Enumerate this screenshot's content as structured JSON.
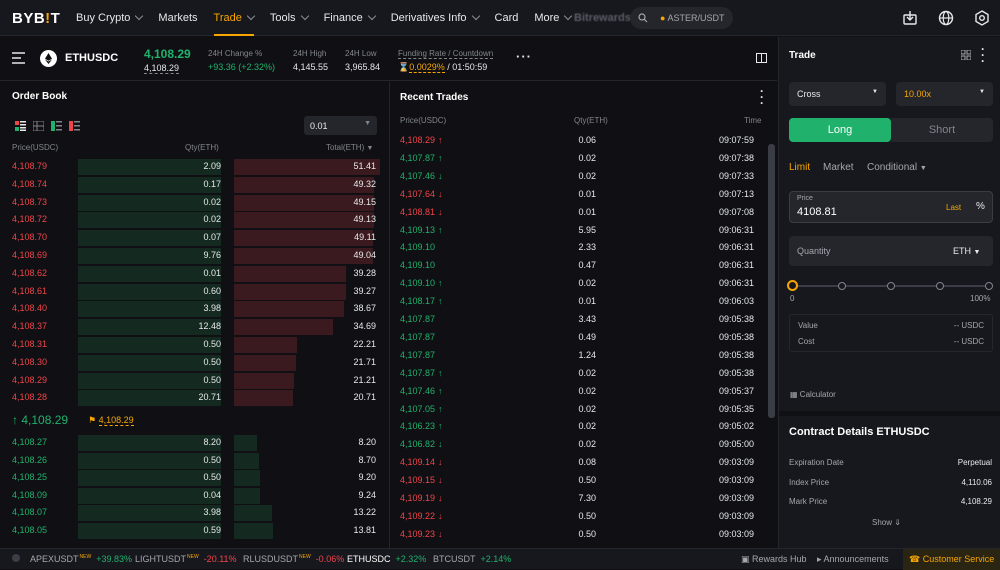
{
  "nav": {
    "logo_main": "BYB",
    "logo_accent": "!",
    "logo_end": "T",
    "items": [
      {
        "label": "Buy Crypto",
        "chevron": true
      },
      {
        "label": "Markets",
        "chevron": false
      },
      {
        "label": "Trade",
        "chevron": true,
        "active": true
      },
      {
        "label": "Tools",
        "chevron": true
      },
      {
        "label": "Finance",
        "chevron": true
      },
      {
        "label": "Derivatives Info",
        "chevron": true
      },
      {
        "label": "Card",
        "chevron": false
      },
      {
        "label": "More",
        "chevron": true
      }
    ],
    "blurred_label": "Bitrewards",
    "search_text": "ASTER/USDT",
    "icons": [
      "download-icon",
      "globe-icon",
      "settings-icon"
    ]
  },
  "ticker": {
    "symbol": "ETHUSDC",
    "last_price": "4,108.29",
    "mark_price": "4,108.29",
    "change_label": "24H Change %",
    "change_value": "+93.36 (+2.32%)",
    "high_label": "24H High",
    "high_value": "4,145.55",
    "low_label": "24H Low",
    "low_value": "3,965.84",
    "funding_label": "Funding Rate / Countdown",
    "funding_rate": "0.0029%",
    "countdown": "/ 01:50:59"
  },
  "orderbook": {
    "title": "Order Book",
    "precision": "0.01",
    "headers": {
      "price": "Price(USDC)",
      "qty": "Qty(ETH)",
      "total": "Total(ETH)"
    },
    "asks": [
      {
        "price": "4,108.79",
        "qty": "2.09",
        "total": "51.41",
        "depth": 1.0
      },
      {
        "price": "4,108.74",
        "qty": "0.17",
        "total": "49.32",
        "depth": 0.96
      },
      {
        "price": "4,108.73",
        "qty": "0.02",
        "total": "49.15",
        "depth": 0.956
      },
      {
        "price": "4,108.72",
        "qty": "0.02",
        "total": "49.13",
        "depth": 0.956
      },
      {
        "price": "4,108.70",
        "qty": "0.07",
        "total": "49.11",
        "depth": 0.955
      },
      {
        "price": "4,108.69",
        "qty": "9.76",
        "total": "49.04",
        "depth": 0.954
      },
      {
        "price": "4,108.62",
        "qty": "0.01",
        "total": "39.28",
        "depth": 0.764
      },
      {
        "price": "4,108.61",
        "qty": "0.60",
        "total": "39.27",
        "depth": 0.764
      },
      {
        "price": "4,108.40",
        "qty": "3.98",
        "total": "38.67",
        "depth": 0.752
      },
      {
        "price": "4,108.37",
        "qty": "12.48",
        "total": "34.69",
        "depth": 0.675
      },
      {
        "price": "4,108.31",
        "qty": "0.50",
        "total": "22.21",
        "depth": 0.432
      },
      {
        "price": "4,108.30",
        "qty": "0.50",
        "total": "21.71",
        "depth": 0.422
      },
      {
        "price": "4,108.29",
        "qty": "0.50",
        "total": "21.21",
        "depth": 0.413
      },
      {
        "price": "4,108.28",
        "qty": "20.71",
        "total": "20.71",
        "depth": 0.403
      }
    ],
    "mid_price": "4,108.29",
    "mid_mark": "4,108.29",
    "bids": [
      {
        "price": "4,108.27",
        "qty": "8.20",
        "total": "8.20",
        "depth": 0.16
      },
      {
        "price": "4,108.26",
        "qty": "0.50",
        "total": "8.70",
        "depth": 0.169
      },
      {
        "price": "4,108.25",
        "qty": "0.50",
        "total": "9.20",
        "depth": 0.179
      },
      {
        "price": "4,108.09",
        "qty": "0.04",
        "total": "9.24",
        "depth": 0.18
      },
      {
        "price": "4,108.07",
        "qty": "3.98",
        "total": "13.22",
        "depth": 0.257
      },
      {
        "price": "4,108.05",
        "qty": "0.59",
        "total": "13.81",
        "depth": 0.269
      }
    ]
  },
  "trades": {
    "title": "Recent Trades",
    "headers": {
      "price": "Price(USDC)",
      "qty": "Qty(ETH)",
      "time": "Time"
    },
    "rows": [
      {
        "price": "4,108.29",
        "dir": "up",
        "side": "sell",
        "qty": "0.06",
        "time": "09:07:59"
      },
      {
        "price": "4,107.87",
        "dir": "up",
        "side": "buy",
        "qty": "0.02",
        "time": "09:07:38"
      },
      {
        "price": "4,107.46",
        "dir": "down",
        "side": "buy",
        "qty": "0.02",
        "time": "09:07:33"
      },
      {
        "price": "4,107.64",
        "dir": "down",
        "side": "sell",
        "qty": "0.01",
        "time": "09:07:13"
      },
      {
        "price": "4,108.81",
        "dir": "down",
        "side": "sell",
        "qty": "0.01",
        "time": "09:07:08"
      },
      {
        "price": "4,109.13",
        "dir": "up",
        "side": "buy",
        "qty": "5.95",
        "time": "09:06:31"
      },
      {
        "price": "4,109.10",
        "dir": "",
        "side": "buy",
        "qty": "2.33",
        "time": "09:06:31"
      },
      {
        "price": "4,109.10",
        "dir": "",
        "side": "buy",
        "qty": "0.47",
        "time": "09:06:31"
      },
      {
        "price": "4,109.10",
        "dir": "up",
        "side": "buy",
        "qty": "0.02",
        "time": "09:06:31"
      },
      {
        "price": "4,108.17",
        "dir": "up",
        "side": "buy",
        "qty": "0.01",
        "time": "09:06:03"
      },
      {
        "price": "4,107.87",
        "dir": "",
        "side": "buy",
        "qty": "3.43",
        "time": "09:05:38"
      },
      {
        "price": "4,107.87",
        "dir": "",
        "side": "buy",
        "qty": "0.49",
        "time": "09:05:38"
      },
      {
        "price": "4,107.87",
        "dir": "",
        "side": "buy",
        "qty": "1.24",
        "time": "09:05:38"
      },
      {
        "price": "4,107.87",
        "dir": "up",
        "side": "buy",
        "qty": "0.02",
        "time": "09:05:38"
      },
      {
        "price": "4,107.46",
        "dir": "up",
        "side": "buy",
        "qty": "0.02",
        "time": "09:05:37"
      },
      {
        "price": "4,107.05",
        "dir": "up",
        "side": "buy",
        "qty": "0.02",
        "time": "09:05:35"
      },
      {
        "price": "4,106.23",
        "dir": "up",
        "side": "buy",
        "qty": "0.02",
        "time": "09:05:02"
      },
      {
        "price": "4,106.82",
        "dir": "down",
        "side": "buy",
        "qty": "0.02",
        "time": "09:05:00"
      },
      {
        "price": "4,109.14",
        "dir": "down",
        "side": "sell",
        "qty": "0.08",
        "time": "09:03:09"
      },
      {
        "price": "4,109.15",
        "dir": "down",
        "side": "sell",
        "qty": "0.50",
        "time": "09:03:09"
      },
      {
        "price": "4,109.19",
        "dir": "down",
        "side": "sell",
        "qty": "7.30",
        "time": "09:03:09"
      },
      {
        "price": "4,109.22",
        "dir": "down",
        "side": "sell",
        "qty": "0.50",
        "time": "09:03:09"
      },
      {
        "price": "4,109.23",
        "dir": "down",
        "side": "sell",
        "qty": "0.50",
        "time": "09:03:09"
      }
    ]
  },
  "trade_panel": {
    "title": "Trade",
    "margin_mode": "Cross",
    "leverage": "10.00x",
    "long_label": "Long",
    "short_label": "Short",
    "order_types": [
      "Limit",
      "Market",
      "Conditional"
    ],
    "price_label": "Price",
    "price_value": "4108.81",
    "last_label": "Last",
    "quantity_label": "Quantity",
    "quantity_unit": "ETH",
    "slider_min": "0",
    "slider_max": "100%",
    "slider_value": 0,
    "value_label": "Value",
    "value_value": "-- USDC",
    "cost_label": "Cost",
    "cost_value": "-- USDC",
    "calculator_label": "Calculator",
    "contract_title": "Contract Details ETHUSDC",
    "contract_rows": [
      {
        "label": "Expiration Date",
        "value": "Perpetual"
      },
      {
        "label": "Index Price",
        "value": "4,110.06"
      },
      {
        "label": "Mark Price",
        "value": "4,108.29"
      }
    ],
    "show_label": "Show"
  },
  "bottom": {
    "items": [
      {
        "symbol": "APEXUSDT",
        "change": "+39.83%",
        "up": true,
        "new": true
      },
      {
        "symbol": "LIGHTUSDT",
        "change": "-20.11%",
        "up": false,
        "new": true
      },
      {
        "symbol": "RLUSDUSDT",
        "change": "-0.06%",
        "up": false,
        "new": true
      },
      {
        "symbol": "ETHUSDC",
        "change": "+2.32%",
        "up": true,
        "new": false
      },
      {
        "symbol": "BTCUSDT",
        "change": "+2.14%",
        "up": true,
        "new": false
      }
    ],
    "new_badge": "NEW",
    "rewards_hub": "Rewards Hub",
    "announcements": "Announcements",
    "customer_service": "Customer Service"
  },
  "colors": {
    "green": "#20b26c",
    "red": "#ef454a",
    "accent": "#f7a600",
    "bg": "#101014",
    "panel": "#17181e"
  }
}
